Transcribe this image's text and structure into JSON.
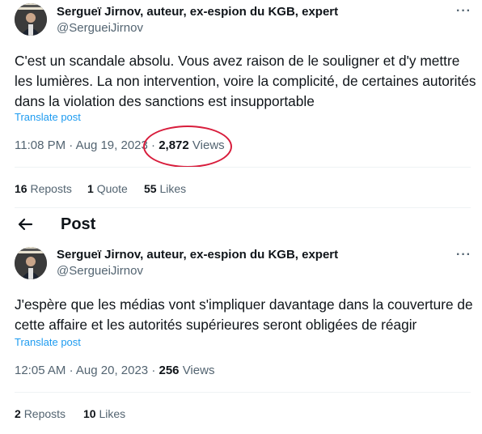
{
  "tweet1": {
    "author_name": "Sergueï Jirnov, auteur, ex-espion du KGB, expert",
    "handle": "@SergueiJirnov",
    "more_label": "···",
    "text": "C'est un scandale absolu. Vous avez raison de le souligner et d'y mettre les lumières. La non intervention, voire la complicité, de certaines autorités dans la violation des sanctions est insupportable",
    "translate": "Translate post",
    "time": "11:08 PM",
    "sep1": "·",
    "date": "Aug 19, 2023",
    "sep2": "·",
    "views_count": "2,872",
    "views_label": "Views",
    "reposts_count": "16",
    "reposts_label": "Reposts",
    "quotes_count": "1",
    "quotes_label": "Quote",
    "likes_count": "55",
    "likes_label": "Likes"
  },
  "post_header": {
    "back_icon": "arrow-left-icon",
    "title": "Post"
  },
  "tweet2": {
    "author_name": "Sergueï Jirnov, auteur, ex-espion du KGB, expert",
    "handle": "@SergueiJirnov",
    "more_label": "···",
    "text": "J'espère que les médias vont s'impliquer davantage dans la couverture de cette affaire et les autorités supérieures seront obligées de réagir",
    "translate": "Translate post",
    "time": "12:05 AM",
    "sep1": "·",
    "date": "Aug 20, 2023",
    "sep2": "·",
    "views_count": "256",
    "views_label": "Views",
    "reposts_count": "2",
    "reposts_label": "Reposts",
    "likes_count": "10",
    "likes_label": "Likes"
  },
  "colors": {
    "annotation_circle": "#d81d3c",
    "link": "#1d9bf0",
    "secondary_text": "#536471"
  }
}
